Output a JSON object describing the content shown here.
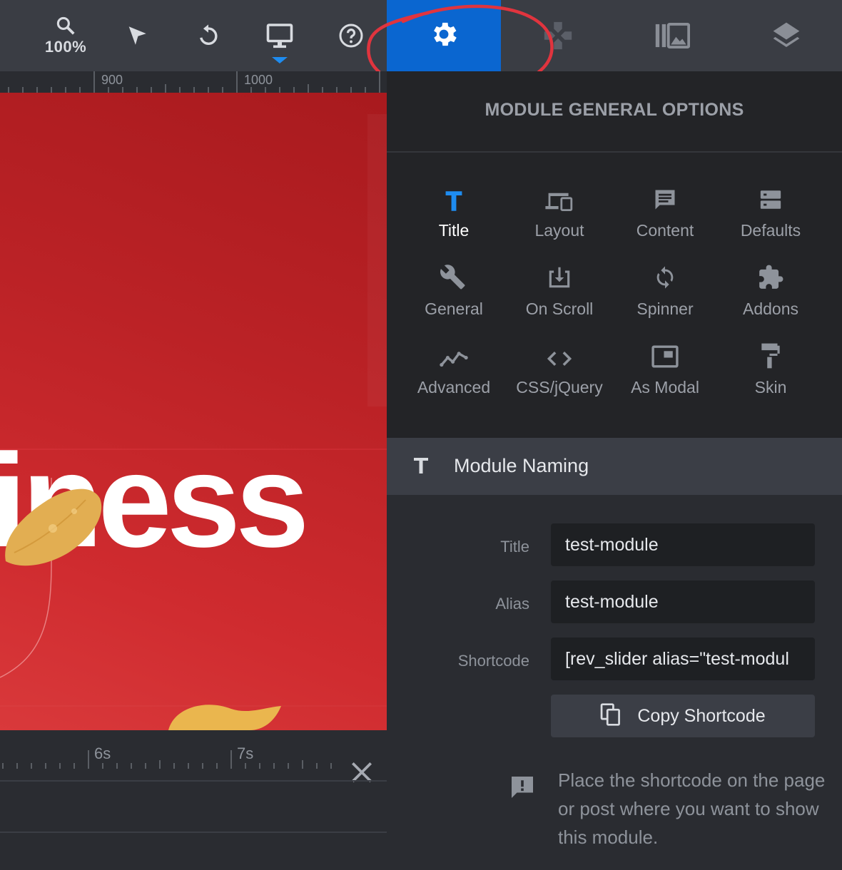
{
  "toolbar": {
    "zoom_label": "100%",
    "icons": [
      "zoom-icon",
      "pointer-icon",
      "undo-icon",
      "desktop-icon",
      "help-icon",
      "gear-icon",
      "gamepad-icon",
      "media-library-icon",
      "layers-icon"
    ],
    "active_color": "#0a66d0"
  },
  "ruler": {
    "labels": [
      "900",
      "1000"
    ]
  },
  "canvas": {
    "word": "iness",
    "background": "#c72529"
  },
  "timeline": {
    "labels": [
      "6s",
      "7s"
    ]
  },
  "panel": {
    "title": "MODULE GENERAL OPTIONS",
    "options": [
      {
        "label": "Title",
        "icon": "title-icon"
      },
      {
        "label": "Layout",
        "icon": "devices-icon"
      },
      {
        "label": "Content",
        "icon": "message-icon"
      },
      {
        "label": "Defaults",
        "icon": "storage-icon"
      },
      {
        "label": "General",
        "icon": "wrench-icon"
      },
      {
        "label": "On Scroll",
        "icon": "scroll-download-icon"
      },
      {
        "label": "Spinner",
        "icon": "sync-icon"
      },
      {
        "label": "Addons",
        "icon": "puzzle-icon"
      },
      {
        "label": "Advanced",
        "icon": "trend-icon"
      },
      {
        "label": "CSS/jQuery",
        "icon": "code-icon"
      },
      {
        "label": "As Modal",
        "icon": "modal-icon"
      },
      {
        "label": "Skin",
        "icon": "paint-roller-icon"
      }
    ],
    "selected_option": "Title"
  },
  "section": {
    "title": "Module Naming",
    "fields": {
      "title_label": "Title",
      "title_value": "test-module",
      "alias_label": "Alias",
      "alias_value": "test-module",
      "shortcode_label": "Shortcode",
      "shortcode_value": "[rev_slider alias=\"test-modul"
    },
    "copy_button": "Copy Shortcode",
    "info": "Place the shortcode on the page or post where you want to show this module."
  }
}
